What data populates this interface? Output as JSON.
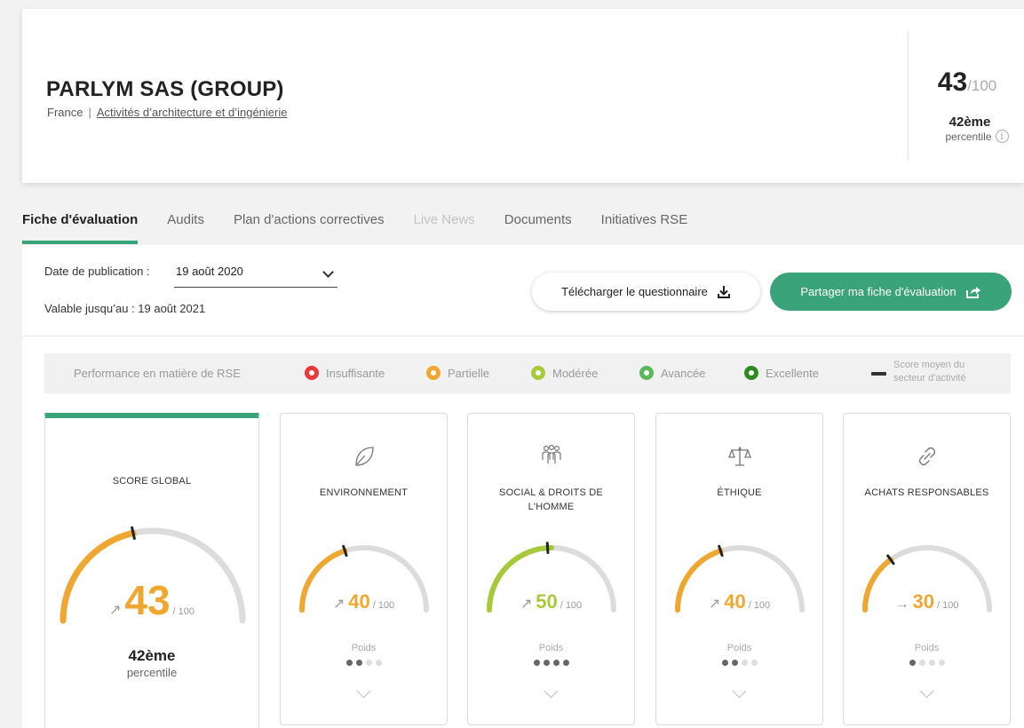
{
  "company": {
    "name": "PARLYM SAS (GROUP)",
    "country": "France",
    "separator": "|",
    "sector": "Activités d’architecture et d’ingénierie",
    "score": "43",
    "score_of": "/100",
    "rank": "42ème",
    "rank_label": "percentile",
    "info_glyph": "i"
  },
  "tabs": [
    {
      "label": "Fiche d'évaluation",
      "state": "active"
    },
    {
      "label": "Audits",
      "state": "normal"
    },
    {
      "label": "Plan d'actions correctives",
      "state": "normal"
    },
    {
      "label": "Live News",
      "state": "disabled"
    },
    {
      "label": "Documents",
      "state": "normal"
    },
    {
      "label": "Initiatives RSE",
      "state": "normal"
    }
  ],
  "publication": {
    "label": "Date de publication :",
    "selected": "19 août 2020",
    "valid_until": "Valable jusqu’au : 19 août 2021"
  },
  "buttons": {
    "download": "Télécharger le questionnaire",
    "share": "Partager ma fiche d'évaluation"
  },
  "legend": {
    "title": "Performance en matière de RSE",
    "items": [
      {
        "label": "Insuffisante",
        "color": "#e83a3a"
      },
      {
        "label": "Partielle",
        "color": "#f0a72f"
      },
      {
        "label": "Modérée",
        "color": "#a8c93a"
      },
      {
        "label": "Avancée",
        "color": "#5cb85c"
      },
      {
        "label": "Excellente",
        "color": "#2e8b1f"
      }
    ],
    "average_line1": "Score moyen du",
    "average_line2": "secteur d'activité"
  },
  "global": {
    "title": "SCORE GLOBAL",
    "arrow": "↗",
    "score": "43",
    "score_value": 43,
    "of": "/ 100",
    "color": "#f0a72f",
    "sector_average": 43,
    "rank": "42ème",
    "rank_label": "percentile"
  },
  "categories": [
    {
      "title1": "ENVIRONNEMENT",
      "title2": "",
      "icon": "leaf-icon",
      "arrow": "↗",
      "score": "40",
      "score_value": 40,
      "of": "/ 100",
      "color": "#f0a72f",
      "sector_average": 40,
      "poids_label": "Poids",
      "weight": 2
    },
    {
      "title1": "SOCIAL & DROITS DE",
      "title2": "L'HOMME",
      "icon": "people-icon",
      "arrow": "↗",
      "score": "50",
      "score_value": 50,
      "of": "/ 100",
      "color": "#a8c93a",
      "sector_average": 48,
      "poids_label": "Poids",
      "weight": 4
    },
    {
      "title1": "ÉTHIQUE",
      "title2": "",
      "icon": "scales-icon",
      "arrow": "↗",
      "score": "40",
      "score_value": 40,
      "of": "/ 100",
      "color": "#f0a72f",
      "sector_average": 40,
      "poids_label": "Poids",
      "weight": 2
    },
    {
      "title1": "ACHATS RESPONSABLES",
      "title2": "",
      "icon": "link-icon",
      "arrow": "→",
      "score": "30",
      "score_value": 30,
      "of": "/ 100",
      "color": "#f0a72f",
      "sector_average": 30,
      "poids_label": "Poids",
      "weight": 1
    }
  ]
}
